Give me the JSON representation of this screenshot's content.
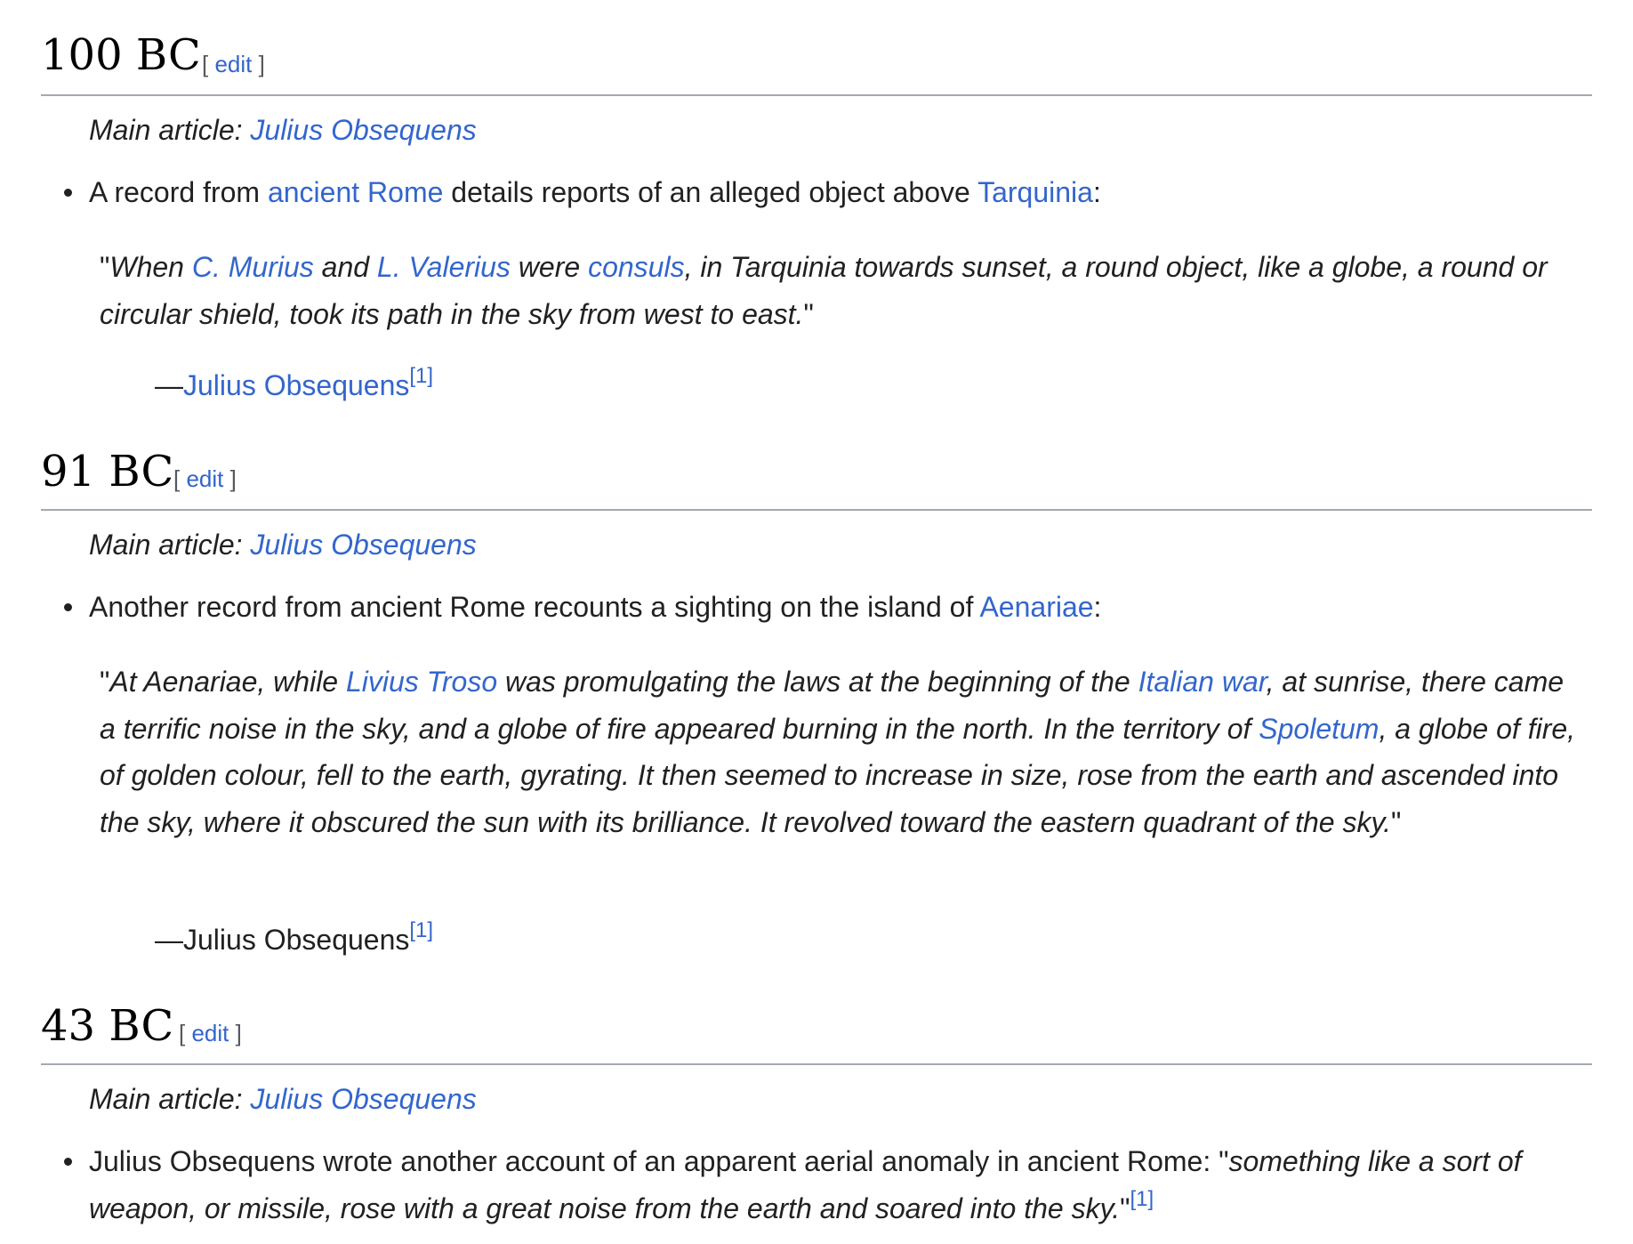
{
  "sections": [
    {
      "heading": "100 BC",
      "edit_open": "[",
      "edit_label": "edit",
      "edit_close": "]",
      "hatnote_prefix": "Main article:",
      "hatnote_link": "Julius Obsequens",
      "bullet": {
        "t1": "A record from ",
        "l1": "ancient Rome",
        "t2": " details reports of an alleged object above ",
        "l2": "Tarquinia",
        "t3": ":"
      },
      "quote": {
        "t1": "\"",
        "i1": "When ",
        "l1": "C. Murius",
        "i2": " and ",
        "l2": "L. Valerius",
        "i3": " were ",
        "l3": "consuls",
        "i4": ", in Tarquinia towards sunset, a round object, like a globe, a round or circular shield, took its path in the sky from west to east.",
        "t2": "\""
      },
      "citation": {
        "dash": "—",
        "author": "Julius Obsequens",
        "ref": "[1]"
      }
    },
    {
      "heading": "91 BC",
      "edit_open": "[",
      "edit_label": "edit",
      "edit_close": "]",
      "hatnote_prefix": "Main article:",
      "hatnote_link": "Julius Obsequens",
      "bullet": {
        "t1": "Another record from ancient Rome recounts a sighting on the island of ",
        "l1": "Aenariae",
        "t2": ":"
      },
      "quote": {
        "t1": "\"",
        "i1": "At Aenariae, while ",
        "l1": "Livius Troso",
        "i2": " was promulgating the laws at the beginning of the ",
        "l2": "Italian war",
        "i3": ", at sunrise, there came a terrific noise in the sky, and a globe of fire appeared burning in the north. In the territory of ",
        "l3": "Spoletum",
        "i4": ", a globe of fire, of golden colour, fell to the earth, gyrating. It then seemed to increase in size, rose from the earth and ascended into the sky, where it obscured the sun with its brilliance. It revolved toward the eastern quadrant of the sky.",
        "t2": "\""
      },
      "citation": {
        "dash": "—",
        "author": "Julius Obsequens",
        "ref": "[1]"
      }
    },
    {
      "heading": "43 BC",
      "edit_open": "[",
      "edit_label": "edit",
      "edit_close": "]",
      "hatnote_prefix": "Main article:",
      "hatnote_link": "Julius Obsequens",
      "bullet": {
        "t1": "Julius Obsequens wrote another account of an apparent aerial anomaly in ancient Rome: \"",
        "i1": "something like a sort of weapon, or missile, rose with a great noise from the earth and soared into the sky.",
        "t2": "\"",
        "ref": "[1]"
      }
    }
  ]
}
